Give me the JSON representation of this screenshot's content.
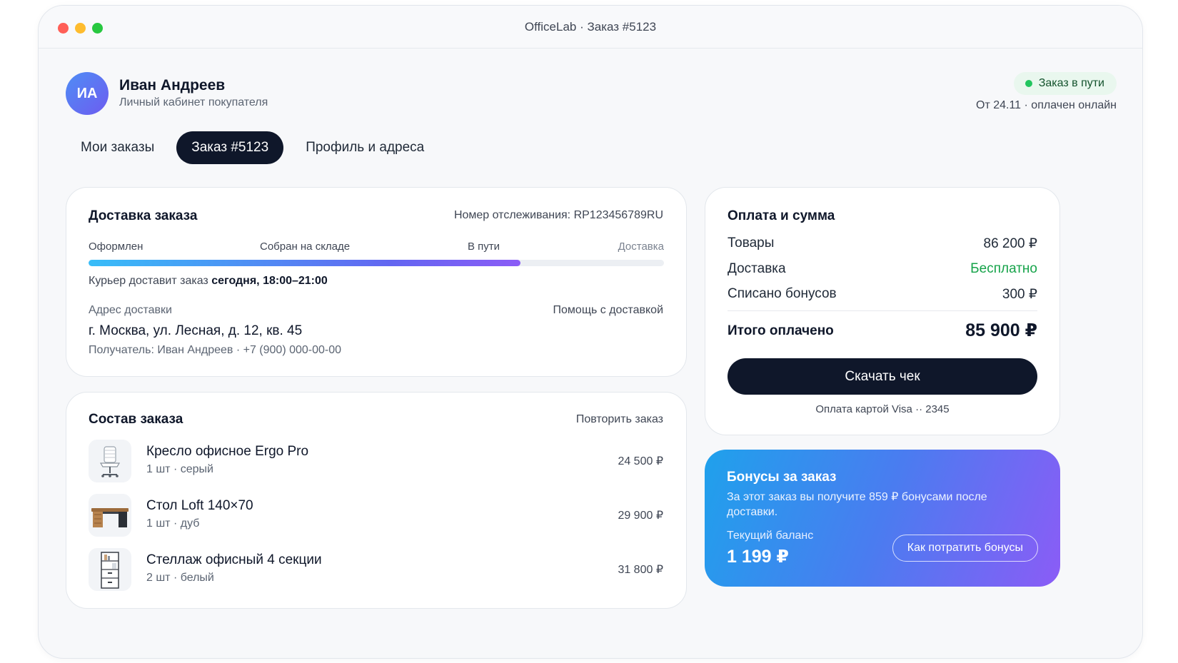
{
  "window": {
    "title": "OfficeLab · Заказ #5123"
  },
  "user": {
    "initials": "ИА",
    "name": "Иван Андреев",
    "subtitle": "Личный кабинет покупателя"
  },
  "status": {
    "badge": "Заказ в пути",
    "meta": "От 24.11 · оплачен онлайн",
    "color": "#22c55e"
  },
  "tabs": [
    {
      "label": "Мои заказы",
      "active": false
    },
    {
      "label": "Заказ #5123",
      "active": true
    },
    {
      "label": "Профиль и адреса",
      "active": false
    }
  ],
  "delivery": {
    "title": "Доставка заказа",
    "tracking": "Номер отслеживания: RP123456789RU",
    "steps": [
      "Оформлен",
      "Собран на складе",
      "В пути",
      "Доставка"
    ],
    "progress": 0.75,
    "eta_prefix": "Курьер доставит заказ",
    "eta_value": "сегодня, 18:00–21:00",
    "address_label": "Адрес доставки",
    "help_link": "Помощь с доставкой",
    "address": "г. Москва, ул. Лесная, д. 12, кв. 45",
    "recipient": "Получатель: Иван Андреев · +7 (900) 000-00-00"
  },
  "items": {
    "title": "Состав заказа",
    "repeat_link": "Повторить заказ",
    "list": [
      {
        "name": "Кресло офисное Ergo Pro",
        "details": "1 шт · серый",
        "price": "24 500 ₽",
        "icon": "office-chair-icon"
      },
      {
        "name": "Стол Loft 140×70",
        "details": "1 шт · дуб",
        "price": "29 900 ₽",
        "icon": "desk-icon"
      },
      {
        "name": "Стеллаж офисный 4 секции",
        "details": "2 шт · белый",
        "price": "31 800 ₽",
        "icon": "shelving-icon"
      }
    ]
  },
  "payment": {
    "title": "Оплата и сумма",
    "rows": [
      {
        "label": "Товары",
        "value": "86 200 ₽"
      },
      {
        "label": "Доставка",
        "value": "Бесплатно"
      },
      {
        "label": "Списано бонусов",
        "value": "300 ₽"
      }
    ],
    "total_label": "Итого оплачено",
    "total_value": "85 900 ₽",
    "download_button": "Скачать чек",
    "card_info": "Оплата картой Visa ·· 2345"
  },
  "bonus": {
    "title": "Бонусы за заказ",
    "description": "За этот заказ вы получите 859 ₽ бонусами после доставки.",
    "balance_label": "Текущий баланс",
    "balance": "1 199 ₽",
    "button": "Как потратить бонусы"
  }
}
